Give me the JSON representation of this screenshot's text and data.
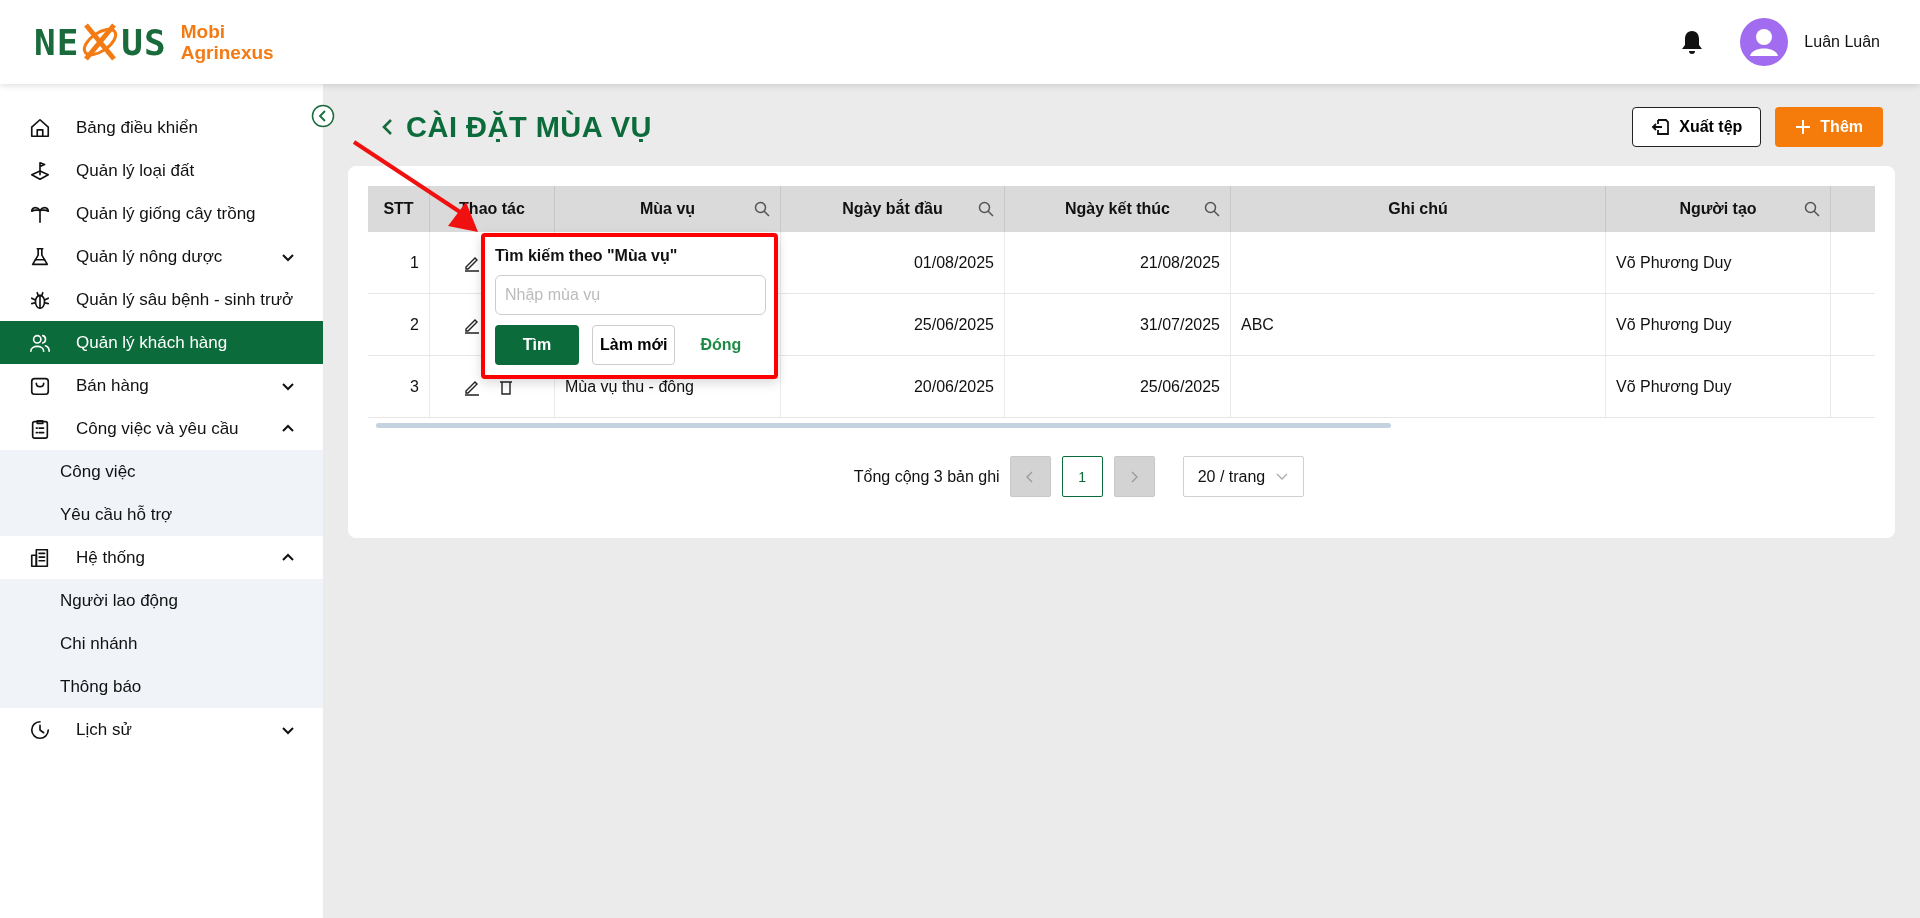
{
  "brand": {
    "logo_left": "NE",
    "logo_right": "US",
    "name_lines": [
      "Mobi",
      "Agrinexus"
    ]
  },
  "header": {
    "user_name": "Luân Luân"
  },
  "sidebar": {
    "items": [
      {
        "label": "Bảng điều khiển",
        "selected": false
      },
      {
        "label": "Quản lý loại đất",
        "selected": false
      },
      {
        "label": "Quản lý giống cây trồng",
        "selected": false
      },
      {
        "label": "Quản lý nông dược",
        "selected": false,
        "expanded": false
      },
      {
        "label": "Quản lý sâu bệnh - sinh trưở",
        "selected": false
      },
      {
        "label": "Quản lý khách hàng",
        "selected": true
      },
      {
        "label": "Bán hàng",
        "selected": false,
        "expanded": false
      },
      {
        "label": "Công việc và yêu cầu",
        "selected": false,
        "expanded": true,
        "children": [
          {
            "label": "Công việc",
            "selected": false
          },
          {
            "label": "Yêu cầu hỗ trợ",
            "selected": false
          }
        ]
      },
      {
        "label": "Hệ thống",
        "selected": false,
        "expanded": true,
        "children": [
          {
            "label": "Người lao động",
            "selected": false
          },
          {
            "label": "Chi nhánh",
            "selected": false
          },
          {
            "label": "Thông báo",
            "selected": false
          }
        ]
      },
      {
        "label": "Lịch sử",
        "selected": false,
        "expanded": false
      }
    ]
  },
  "page": {
    "title": "CÀI ĐẶT MÙA VỤ",
    "export_button": "Xuất tệp",
    "add_button": "Thêm"
  },
  "table": {
    "columns": [
      {
        "label": "STT",
        "searchable": false
      },
      {
        "label": "Thao tác",
        "searchable": false
      },
      {
        "label": "Mùa vụ",
        "searchable": true
      },
      {
        "label": "Ngày bắt đầu",
        "searchable": true
      },
      {
        "label": "Ngày kết thúc",
        "searchable": true
      },
      {
        "label": "Ghi chú",
        "searchable": false
      },
      {
        "label": "Người tạo",
        "searchable": true
      }
    ],
    "rows": [
      {
        "stt": "1",
        "start": "01/08/2025",
        "end": "21/08/2025",
        "creator": "Võ Phương Duy"
      },
      {
        "stt": "2",
        "start": "25/06/2025",
        "end": "31/07/2025",
        "note": "ABC",
        "creator": "Võ Phương Duy"
      },
      {
        "stt": "3",
        "season": "Mùa vụ thu - đông",
        "start": "20/06/2025",
        "end": "25/06/2025",
        "creator": "Võ Phương Duy"
      }
    ]
  },
  "filter_popup": {
    "title": "Tìm kiếm theo \"Mùa vụ\"",
    "placeholder": "Nhập mùa vụ",
    "search_button": "Tìm",
    "reset_button": "Làm mới",
    "close_button": "Đóng"
  },
  "pagination": {
    "total": "Tổng cộng 3 bản ghi",
    "prev_disabled": true,
    "pages": [
      {
        "label": "1",
        "selected": true
      }
    ],
    "next_disabled": true,
    "page_size": "20 / trang"
  }
}
